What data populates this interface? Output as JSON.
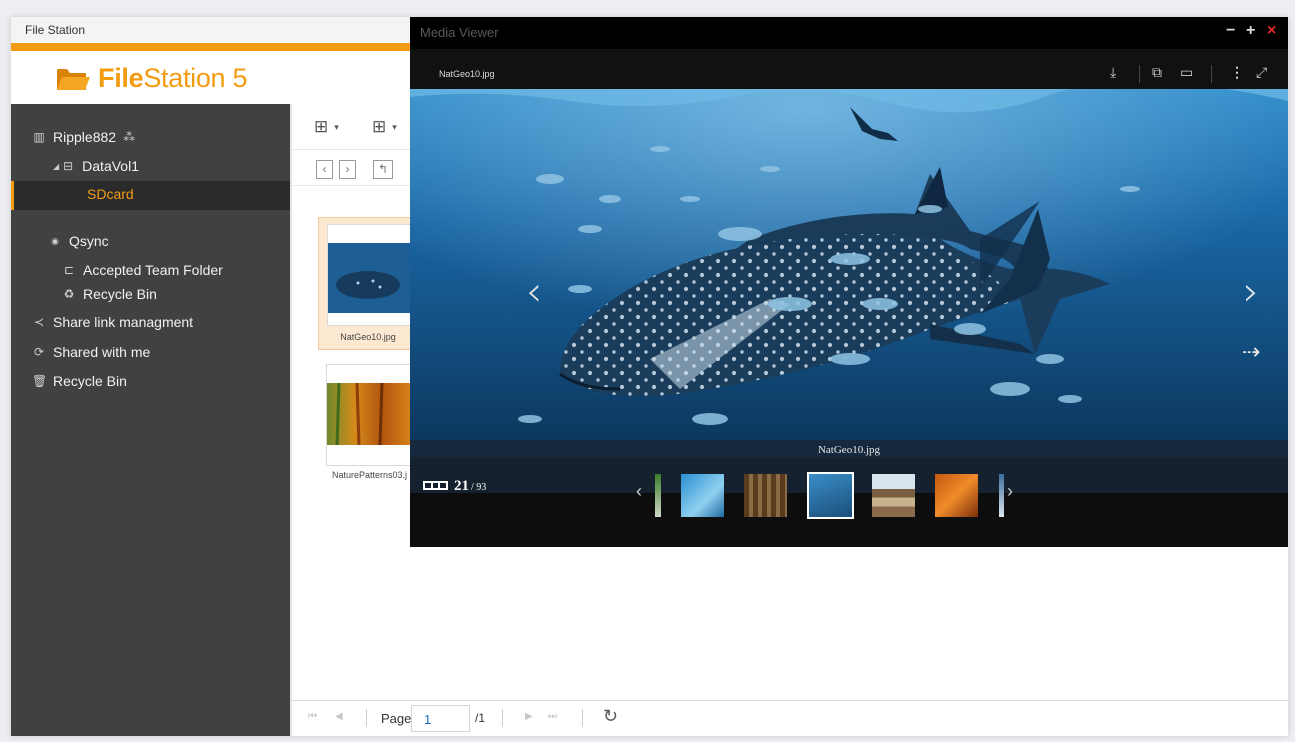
{
  "file_station": {
    "window_title": "File Station",
    "logo": {
      "bold": "File",
      "rest": "Station 5"
    },
    "sidebar": {
      "root": "Ripple882",
      "volume": "DataVol1",
      "selected": "SDcard",
      "qsync": "Qsync",
      "accepted_team_folder": "Accepted Team Folder",
      "qsync_recycle_bin": "Recycle Bin",
      "share_link": "Share link managment",
      "shared_with_me": "Shared with me",
      "recycle_bin": "Recycle Bin"
    },
    "files": [
      {
        "name": "NatGeo10.jpg"
      },
      {
        "name": "NaturePatterns03.j"
      }
    ],
    "pager": {
      "page_label": "Page",
      "page_value": "1",
      "page_total": "/1"
    }
  },
  "media_viewer": {
    "window_title": "Media Viewer",
    "filename": "NatGeo10.jpg",
    "caption": "NatGeo10.jpg",
    "counter": {
      "index": "21",
      "total": "/ 93"
    },
    "window_buttons": {
      "minimize": "−",
      "maximize": "+",
      "close": "×"
    },
    "colors": {
      "accent": "#f39c12",
      "close": "#e32b2b"
    }
  }
}
